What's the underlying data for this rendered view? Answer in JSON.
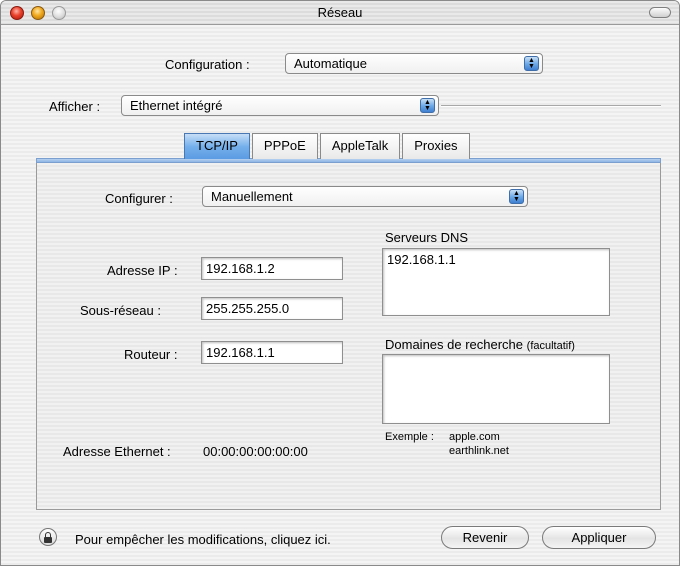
{
  "window": {
    "title": "Réseau"
  },
  "configuration": {
    "label": "Configuration :",
    "value": "Automatique"
  },
  "afficher": {
    "label": "Afficher :",
    "value": "Ethernet intégré"
  },
  "tabs": [
    {
      "label": "TCP/IP",
      "active": true
    },
    {
      "label": "PPPoE",
      "active": false
    },
    {
      "label": "AppleTalk",
      "active": false
    },
    {
      "label": "Proxies",
      "active": false
    }
  ],
  "tcpip": {
    "configurer_label": "Configurer :",
    "configurer_value": "Manuellement",
    "ip_label": "Adresse IP :",
    "ip_value": "192.168.1.2",
    "subnet_label": "Sous-réseau :",
    "subnet_value": "255.255.255.0",
    "router_label": "Routeur :",
    "router_value": "192.168.1.1",
    "dns_label": "Serveurs DNS",
    "dns_value": "192.168.1.1",
    "search_label": "Domaines de recherche",
    "search_optional": "(facultatif)",
    "search_value": "",
    "example_label": "Exemple :",
    "example_line1": "apple.com",
    "example_line2": "earthlink.net",
    "ethernet_label": "Adresse Ethernet :",
    "ethernet_value": "00:00:00:00:00:00"
  },
  "footer": {
    "lock_text": "Pour empêcher les modifications, cliquez ici.",
    "revert_label": "Revenir",
    "apply_label": "Appliquer"
  },
  "icons": {
    "close": "close-button-icon",
    "minimize": "minimize-button-icon",
    "zoom": "zoom-button-icon",
    "toolbar": "toolbar-toggle-icon",
    "lock": "lock-icon",
    "popup": "updown-arrows-icon"
  }
}
